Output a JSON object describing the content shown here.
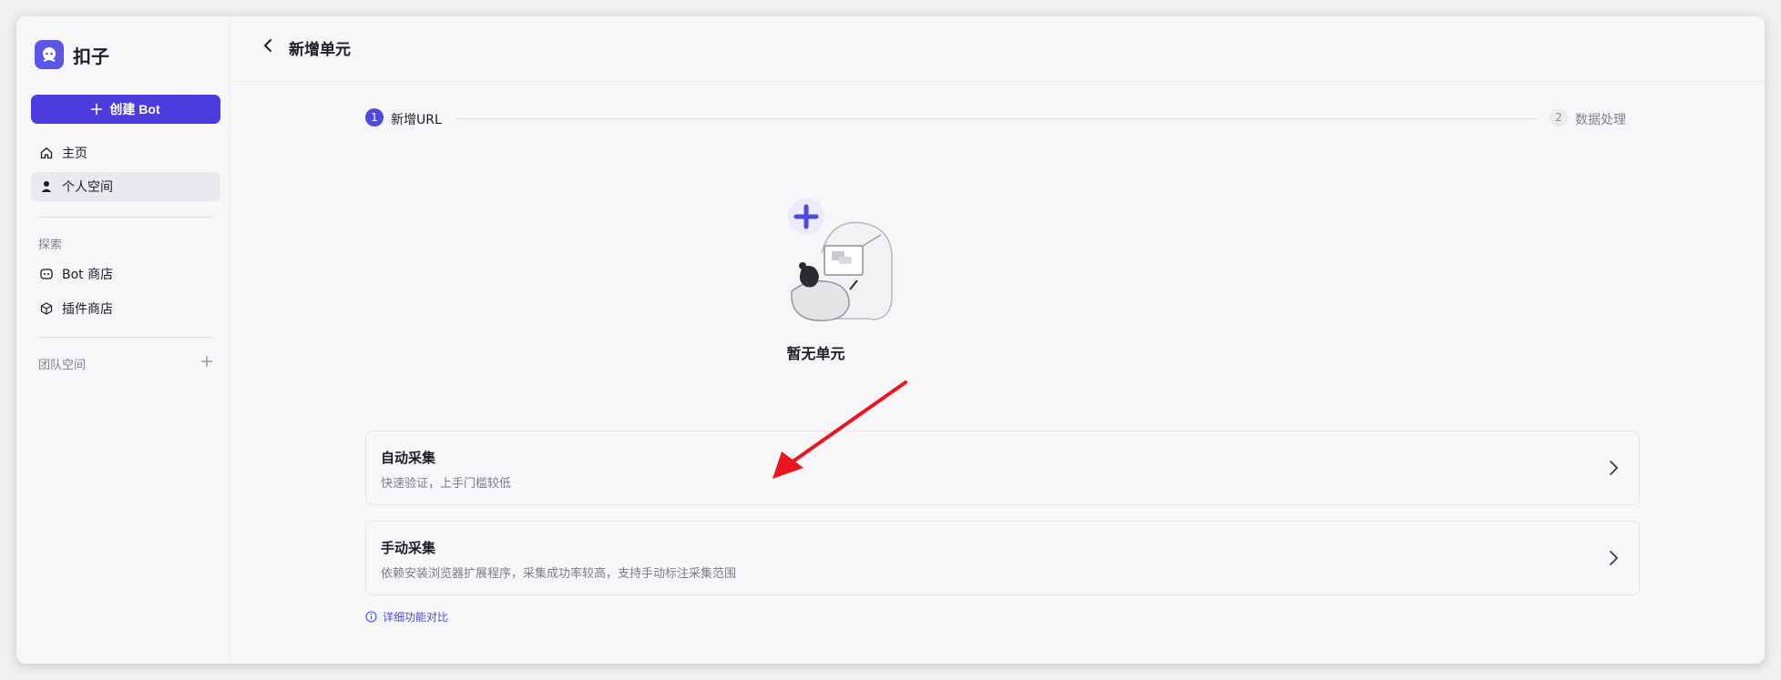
{
  "sidebar": {
    "brand_name": "扣子",
    "create_button": "创建 Bot",
    "nav": {
      "home": "主页",
      "personal_space": "个人空间"
    },
    "explore_label": "探索",
    "explore_items": {
      "bot_store": "Bot 商店",
      "plugin_store": "插件商店"
    },
    "team_label": "团队空间"
  },
  "header": {
    "title": "新增单元"
  },
  "steps": {
    "step1_number": "1",
    "step1_label": "新增URL",
    "step2_number": "2",
    "step2_label": "数据处理"
  },
  "empty_state": {
    "text": "暂无单元"
  },
  "options": {
    "auto": {
      "title": "自动采集",
      "desc": "快速验证，上手门槛较低"
    },
    "manual": {
      "title": "手动采集",
      "desc": "依赖安装浏览器扩展程序，采集成功率较高，支持手动标注采集范围"
    }
  },
  "compare_link": "详细功能对比",
  "colors": {
    "accent": "#4d3ae0",
    "annotation_arrow": "#e8161d"
  }
}
